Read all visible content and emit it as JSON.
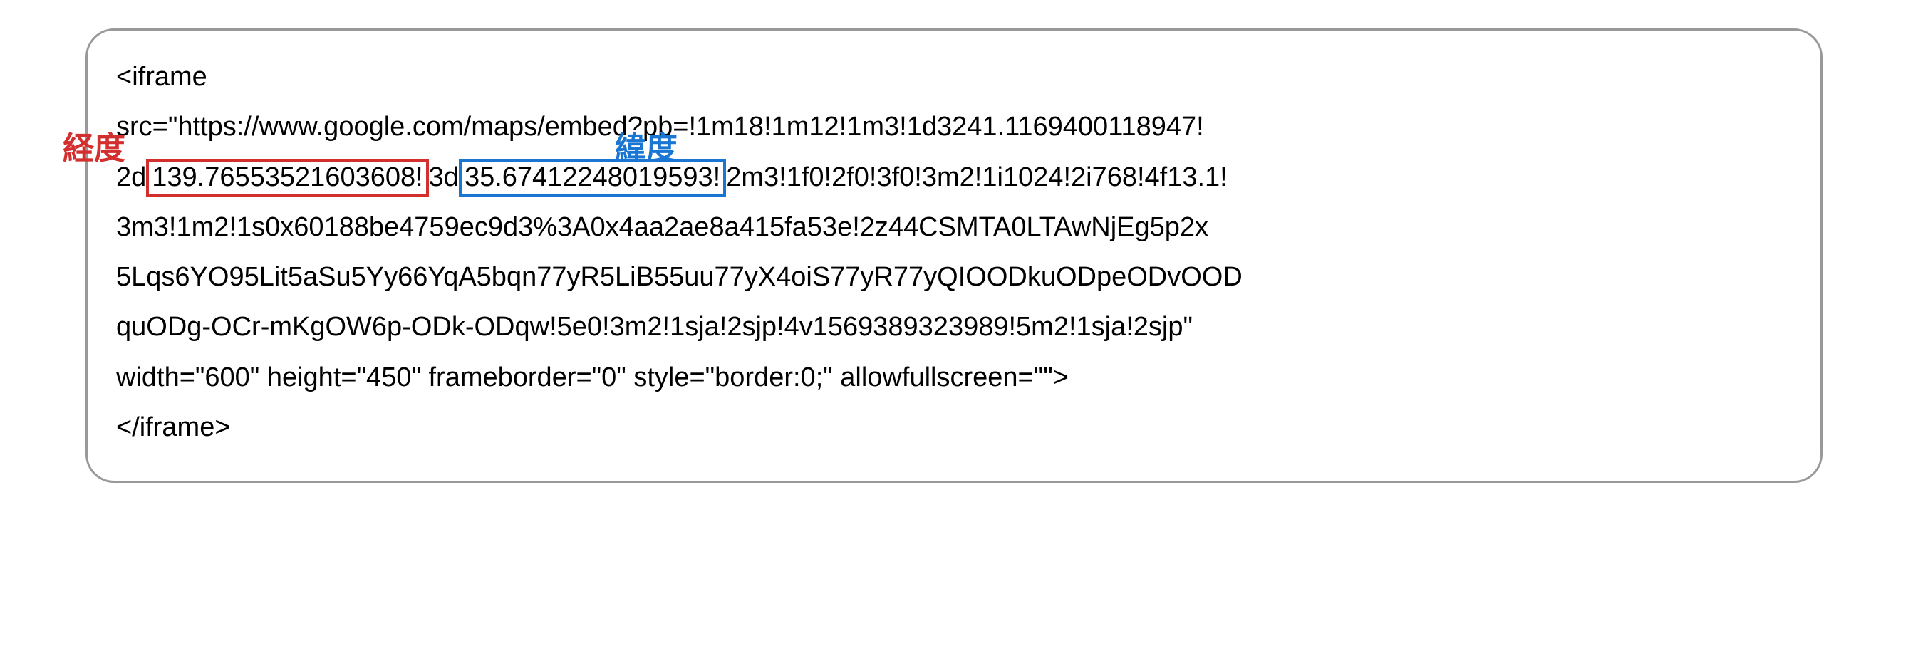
{
  "labels": {
    "longitude": "経度",
    "latitude": "緯度"
  },
  "code": {
    "line1": "<iframe",
    "line2_part1": "src=\"https://www.google.com/maps/embed?pb=!1m18!1m12!1m3!1d3241.1169400118947!",
    "line3_part1": "2d",
    "line3_longitude": "139.76553521603608!",
    "line3_part2": "3d",
    "line3_latitude": "35.67412248019593!",
    "line3_part3": "2m3!1f0!2f0!3f0!3m2!1i1024!2i768!4f13.1!",
    "line4": "3m3!1m2!1s0x60188be4759ec9d3%3A0x4aa2ae8a415fa53e!2z44CSMTA0LTAwNjEg5p2x",
    "line5": "5Lqs6YO95Lit5aSu5Yy66YqA5bqn77yR5LiB55uu77yX4oiS77yR77yQIOODkuODpeODvOOD",
    "line6": "quODg-OCr-mKgOW6p-ODk-ODqw!5e0!3m2!1sja!2sjp!4v1569389323989!5m2!1sja!2sjp\"",
    "line7": " width=\"600\" height=\"450\" frameborder=\"0\" style=\"border:0;\" allowfullscreen=\"\">",
    "line8": "</iframe>"
  }
}
